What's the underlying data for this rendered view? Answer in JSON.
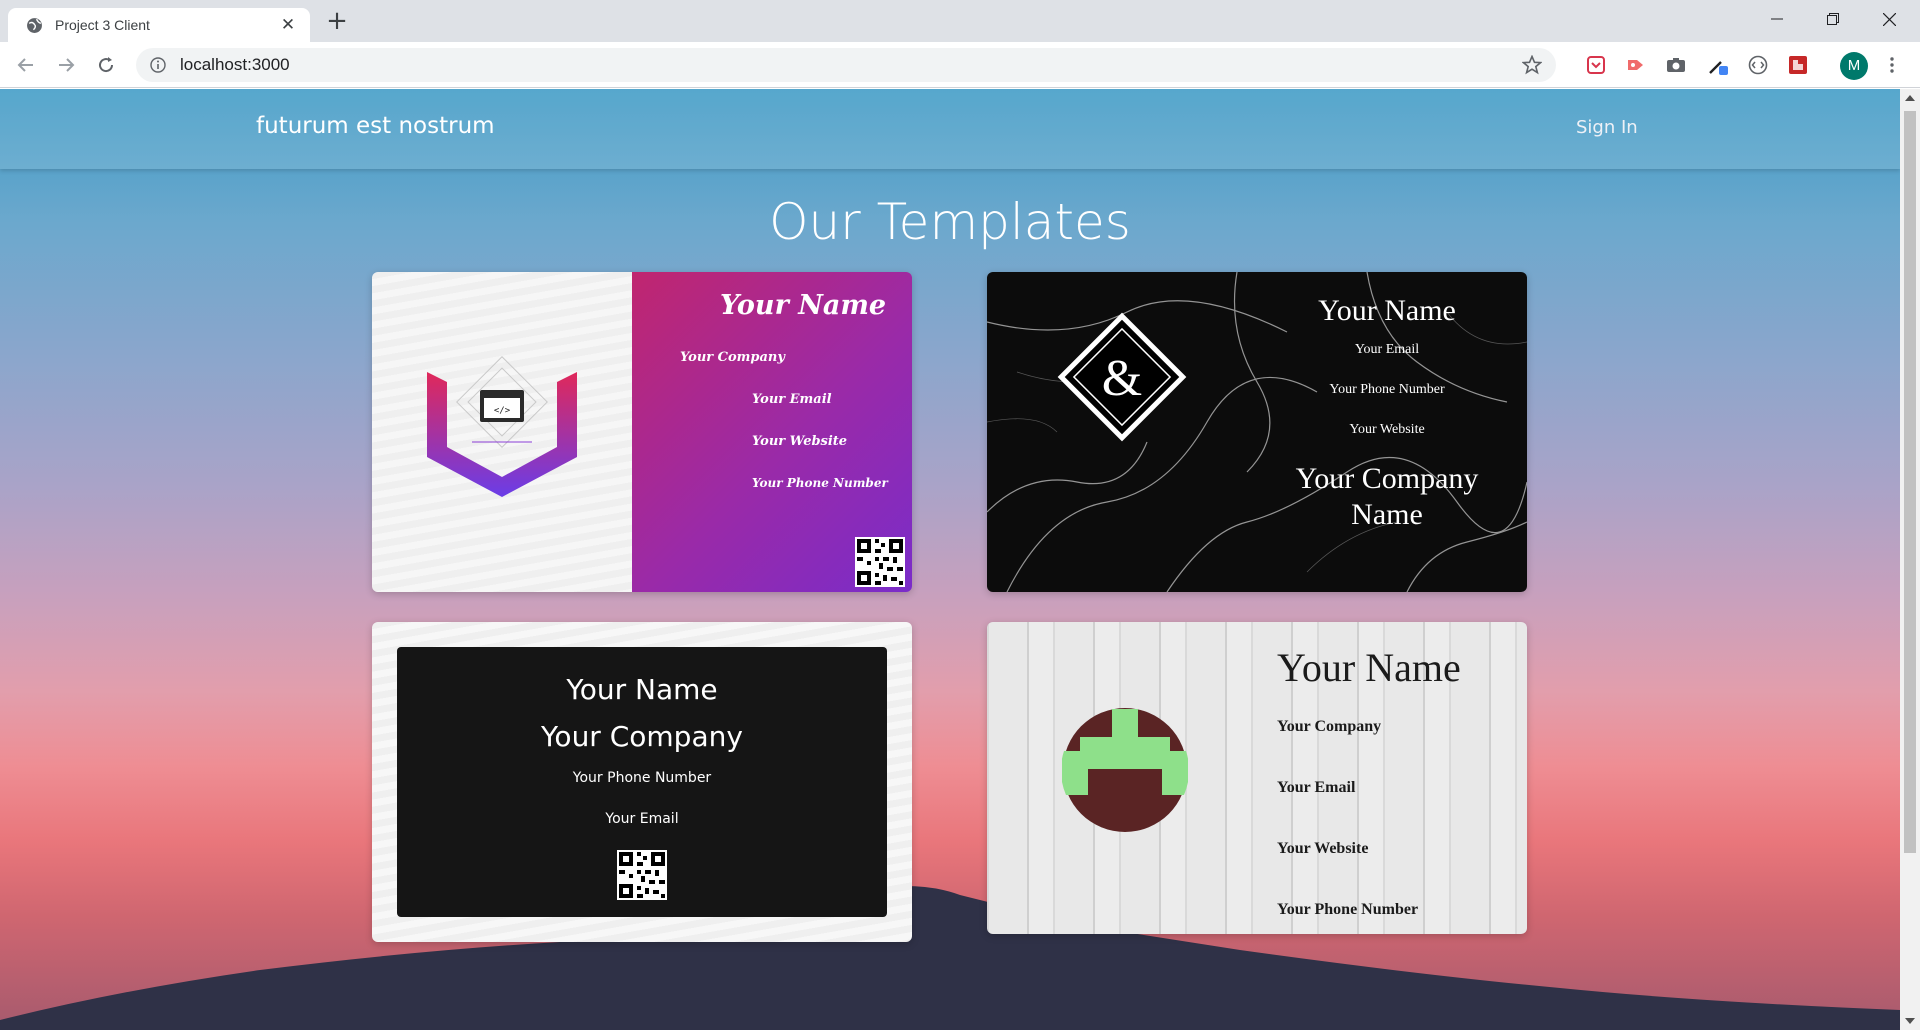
{
  "browser": {
    "tab_title": "Project 3 Client",
    "url": "localhost:3000",
    "avatar_letter": "M"
  },
  "navbar": {
    "brand": "futurum est nostrum",
    "signin": "Sign In"
  },
  "main": {
    "title": "Our Templates"
  },
  "templates": [
    {
      "name": "Your Name",
      "company": "Your Company",
      "email": "Your Email",
      "website": "Your Website",
      "phone": "Your Phone Number"
    },
    {
      "name": "Your Name",
      "email": "Your Email",
      "phone": "Your Phone Number",
      "website": "Your Website",
      "company_line1": "Your Company",
      "company_line2": "Name",
      "logo_glyph": "&"
    },
    {
      "name": "Your Name",
      "company": "Your Company",
      "phone": "Your Phone Number",
      "email": "Your Email"
    },
    {
      "name": "Your Name",
      "company": "Your Company",
      "email": "Your Email",
      "website": "Your Website",
      "phone": "Your Phone Number"
    }
  ],
  "colors": {
    "card1_gradient_start": "#c0266f",
    "card1_gradient_end": "#7a2cc9",
    "card4_logo_circle": "#5a2424",
    "card4_logo_mark": "#8ee08a"
  }
}
